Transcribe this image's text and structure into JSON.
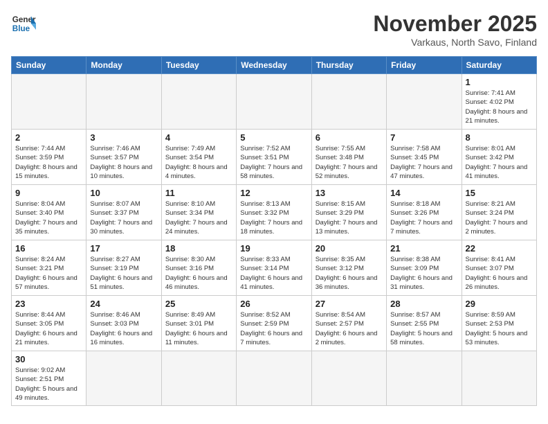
{
  "header": {
    "logo_general": "General",
    "logo_blue": "Blue",
    "title": "November 2025",
    "subtitle": "Varkaus, North Savo, Finland"
  },
  "weekdays": [
    "Sunday",
    "Monday",
    "Tuesday",
    "Wednesday",
    "Thursday",
    "Friday",
    "Saturday"
  ],
  "weeks": [
    [
      {
        "day": "",
        "info": "",
        "empty": true
      },
      {
        "day": "",
        "info": "",
        "empty": true
      },
      {
        "day": "",
        "info": "",
        "empty": true
      },
      {
        "day": "",
        "info": "",
        "empty": true
      },
      {
        "day": "",
        "info": "",
        "empty": true
      },
      {
        "day": "",
        "info": "",
        "empty": true
      },
      {
        "day": "1",
        "info": "Sunrise: 7:41 AM\nSunset: 4:02 PM\nDaylight: 8 hours\nand 21 minutes."
      }
    ],
    [
      {
        "day": "2",
        "info": "Sunrise: 7:44 AM\nSunset: 3:59 PM\nDaylight: 8 hours\nand 15 minutes."
      },
      {
        "day": "3",
        "info": "Sunrise: 7:46 AM\nSunset: 3:57 PM\nDaylight: 8 hours\nand 10 minutes."
      },
      {
        "day": "4",
        "info": "Sunrise: 7:49 AM\nSunset: 3:54 PM\nDaylight: 8 hours\nand 4 minutes."
      },
      {
        "day": "5",
        "info": "Sunrise: 7:52 AM\nSunset: 3:51 PM\nDaylight: 7 hours\nand 58 minutes."
      },
      {
        "day": "6",
        "info": "Sunrise: 7:55 AM\nSunset: 3:48 PM\nDaylight: 7 hours\nand 52 minutes."
      },
      {
        "day": "7",
        "info": "Sunrise: 7:58 AM\nSunset: 3:45 PM\nDaylight: 7 hours\nand 47 minutes."
      },
      {
        "day": "8",
        "info": "Sunrise: 8:01 AM\nSunset: 3:42 PM\nDaylight: 7 hours\nand 41 minutes."
      }
    ],
    [
      {
        "day": "9",
        "info": "Sunrise: 8:04 AM\nSunset: 3:40 PM\nDaylight: 7 hours\nand 35 minutes."
      },
      {
        "day": "10",
        "info": "Sunrise: 8:07 AM\nSunset: 3:37 PM\nDaylight: 7 hours\nand 30 minutes."
      },
      {
        "day": "11",
        "info": "Sunrise: 8:10 AM\nSunset: 3:34 PM\nDaylight: 7 hours\nand 24 minutes."
      },
      {
        "day": "12",
        "info": "Sunrise: 8:13 AM\nSunset: 3:32 PM\nDaylight: 7 hours\nand 18 minutes."
      },
      {
        "day": "13",
        "info": "Sunrise: 8:15 AM\nSunset: 3:29 PM\nDaylight: 7 hours\nand 13 minutes."
      },
      {
        "day": "14",
        "info": "Sunrise: 8:18 AM\nSunset: 3:26 PM\nDaylight: 7 hours\nand 7 minutes."
      },
      {
        "day": "15",
        "info": "Sunrise: 8:21 AM\nSunset: 3:24 PM\nDaylight: 7 hours\nand 2 minutes."
      }
    ],
    [
      {
        "day": "16",
        "info": "Sunrise: 8:24 AM\nSunset: 3:21 PM\nDaylight: 6 hours\nand 57 minutes."
      },
      {
        "day": "17",
        "info": "Sunrise: 8:27 AM\nSunset: 3:19 PM\nDaylight: 6 hours\nand 51 minutes."
      },
      {
        "day": "18",
        "info": "Sunrise: 8:30 AM\nSunset: 3:16 PM\nDaylight: 6 hours\nand 46 minutes."
      },
      {
        "day": "19",
        "info": "Sunrise: 8:33 AM\nSunset: 3:14 PM\nDaylight: 6 hours\nand 41 minutes."
      },
      {
        "day": "20",
        "info": "Sunrise: 8:35 AM\nSunset: 3:12 PM\nDaylight: 6 hours\nand 36 minutes."
      },
      {
        "day": "21",
        "info": "Sunrise: 8:38 AM\nSunset: 3:09 PM\nDaylight: 6 hours\nand 31 minutes."
      },
      {
        "day": "22",
        "info": "Sunrise: 8:41 AM\nSunset: 3:07 PM\nDaylight: 6 hours\nand 26 minutes."
      }
    ],
    [
      {
        "day": "23",
        "info": "Sunrise: 8:44 AM\nSunset: 3:05 PM\nDaylight: 6 hours\nand 21 minutes."
      },
      {
        "day": "24",
        "info": "Sunrise: 8:46 AM\nSunset: 3:03 PM\nDaylight: 6 hours\nand 16 minutes."
      },
      {
        "day": "25",
        "info": "Sunrise: 8:49 AM\nSunset: 3:01 PM\nDaylight: 6 hours\nand 11 minutes."
      },
      {
        "day": "26",
        "info": "Sunrise: 8:52 AM\nSunset: 2:59 PM\nDaylight: 6 hours\nand 7 minutes."
      },
      {
        "day": "27",
        "info": "Sunrise: 8:54 AM\nSunset: 2:57 PM\nDaylight: 6 hours\nand 2 minutes."
      },
      {
        "day": "28",
        "info": "Sunrise: 8:57 AM\nSunset: 2:55 PM\nDaylight: 5 hours\nand 58 minutes."
      },
      {
        "day": "29",
        "info": "Sunrise: 8:59 AM\nSunset: 2:53 PM\nDaylight: 5 hours\nand 53 minutes."
      }
    ],
    [
      {
        "day": "30",
        "info": "Sunrise: 9:02 AM\nSunset: 2:51 PM\nDaylight: 5 hours\nand 49 minutes."
      },
      {
        "day": "",
        "info": "",
        "empty": true
      },
      {
        "day": "",
        "info": "",
        "empty": true
      },
      {
        "day": "",
        "info": "",
        "empty": true
      },
      {
        "day": "",
        "info": "",
        "empty": true
      },
      {
        "day": "",
        "info": "",
        "empty": true
      },
      {
        "day": "",
        "info": "",
        "empty": true
      }
    ]
  ]
}
